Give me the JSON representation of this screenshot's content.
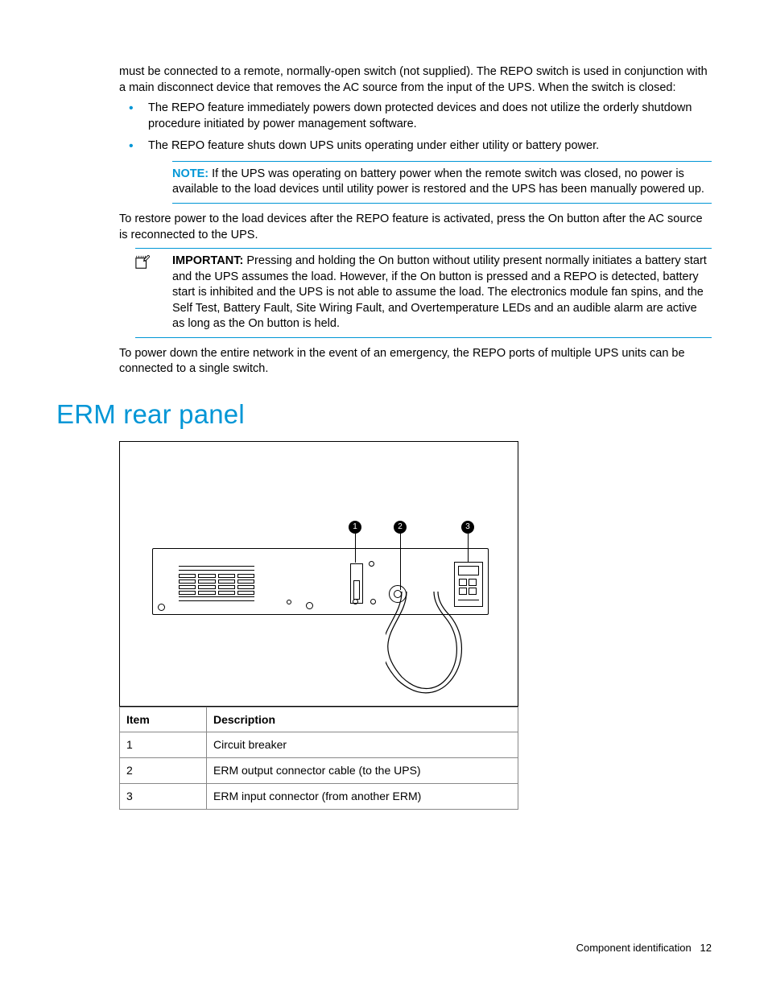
{
  "intro_paragraph": "must be connected to a remote, normally-open switch (not supplied). The REPO switch is used in conjunction with a main disconnect device that removes the AC source from the input of the UPS. When the switch is closed:",
  "bullets": [
    "The REPO feature immediately powers down protected devices and does not utilize the orderly shutdown procedure initiated by power management software.",
    "The REPO feature shuts down UPS units operating under either utility or battery power."
  ],
  "note": {
    "label": "NOTE:",
    "text": "If the UPS was operating on battery power when the remote switch was closed, no power is available to the load devices until utility power is restored and the UPS has been manually powered up."
  },
  "restore_paragraph": "To restore power to the load devices after the REPO feature is activated, press the On button after the AC source is reconnected to the UPS.",
  "important": {
    "label": "IMPORTANT:",
    "text": "Pressing and holding the On button without utility present normally initiates a battery start and the UPS assumes the load. However, if the On button is pressed and a REPO is detected, battery start is inhibited and the UPS is not able to assume the load. The electronics module fan spins, and the Self Test, Battery Fault, Site Wiring Fault, and Overtemperature LEDs and an audible alarm are active as long as the On button is held."
  },
  "powerdown_paragraph": "To power down the entire network in the event of an emergency, the REPO ports of multiple UPS units can be connected to a single switch.",
  "section_heading": "ERM rear panel",
  "table": {
    "headers": {
      "item": "Item",
      "description": "Description"
    },
    "rows": [
      {
        "item": "1",
        "description": "Circuit breaker"
      },
      {
        "item": "2",
        "description": "ERM output connector cable (to the UPS)"
      },
      {
        "item": "3",
        "description": "ERM input connector (from another ERM)"
      }
    ]
  },
  "figure_callouts": [
    "1",
    "2",
    "3"
  ],
  "footer": {
    "section": "Component identification",
    "page": "12"
  }
}
